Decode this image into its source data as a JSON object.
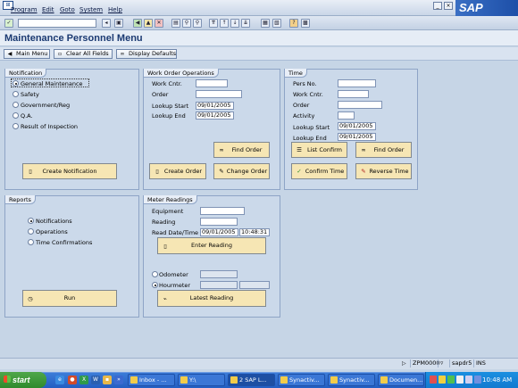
{
  "menu": {
    "items": [
      "Program",
      "Edit",
      "Goto",
      "System",
      "Help"
    ]
  },
  "window": {
    "logo": "SAP",
    "title": "Maintenance Personnel Menu"
  },
  "app_toolbar": {
    "main_menu": "Main Menu",
    "clear_all": "Clear All Fields",
    "display_defaults": "Display Defaults"
  },
  "notification": {
    "title": "Notification",
    "options": [
      "General Maintenance",
      "Safety",
      "Government/Reg",
      "Q.A.",
      "Result of Inspection"
    ],
    "selected": "General Maintenance",
    "create_button": "Create Notification"
  },
  "work_order": {
    "title": "Work Order Operations",
    "work_cntr_label": "Work Cntr.",
    "order_label": "Order",
    "lookup_start_label": "Lookup Start",
    "lookup_start_value": "09/01/2005",
    "lookup_end_label": "Lookup End",
    "lookup_end_value": "09/01/2005",
    "find_order": "Find Order",
    "create_order": "Create Order",
    "change_order": "Change Order"
  },
  "time": {
    "title": "Time",
    "pers_no_label": "Pers No.",
    "work_cntr_label": "Work Cntr.",
    "order_label": "Order",
    "activity_label": "Activity",
    "lookup_start_label": "Lookup Start",
    "lookup_start_value": "09/01/2005",
    "lookup_end_label": "Lookup End",
    "lookup_end_value": "09/01/2005",
    "list_confirm": "List Confirm",
    "find_order": "Find Order",
    "confirm_time": "Confirm Time",
    "reverse_time": "Reverse Time"
  },
  "reports": {
    "title": "Reports",
    "options": [
      "Notifications",
      "Operations",
      "Time Confirmations"
    ],
    "selected": "Notifications",
    "run": "Run"
  },
  "meter": {
    "title": "Meter Readings",
    "equipment_label": "Equipment",
    "reading_label": "Reading",
    "read_datetime_label": "Read Date/Time",
    "read_date_value": "09/01/2005",
    "read_time_value": "10:48:31",
    "enter_reading": "Enter Reading",
    "odometer_label": "Odometer",
    "hourmeter_label": "Hourmeter",
    "selected_meter": "Hourmeter",
    "latest_reading": "Latest Reading"
  },
  "statusbar": {
    "transaction": "ZPM0000",
    "server": "sapdr5",
    "mode": "INS"
  },
  "taskbar": {
    "start": "start",
    "tasks": [
      "Inbox - ...",
      "Y:\\",
      "2 SAP L...",
      "Synactiv...",
      "Synactiv...",
      "Documen..."
    ],
    "clock": "10:48 AM"
  },
  "colors": {
    "background": "#c6d5e6",
    "button_face": "#f6e6b4",
    "title_text": "#1b3a72",
    "taskbar": "#245ec2"
  },
  "icons": [
    "app-icon",
    "enter-check-icon",
    "save-icon",
    "back-icon",
    "exit-icon",
    "cancel-icon",
    "print-icon",
    "find-icon",
    "help-icon",
    "document-icon",
    "binoculars-icon",
    "pencil-icon",
    "clock-icon",
    "gauge-icon"
  ]
}
